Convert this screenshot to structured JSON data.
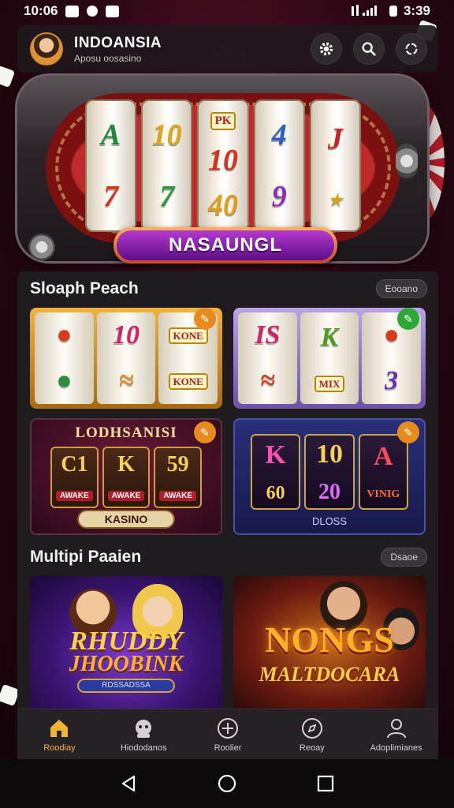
{
  "status_bar": {
    "time": "10:06",
    "clock": "3:39"
  },
  "header": {
    "app_name": "INDOANSIA",
    "subtitle": "Aposu oosasino"
  },
  "hero": {
    "banner": "NASAUNGL",
    "reels": [
      [
        "A",
        "7"
      ],
      [
        "10",
        "7"
      ],
      [
        "10",
        "40"
      ],
      [
        "4",
        "9"
      ],
      [
        "J",
        ""
      ]
    ],
    "tile": "PK"
  },
  "section1": {
    "title": "Sloaph Peach",
    "pill": "Eooano",
    "card1": {
      "reels": [
        [
          "",
          ""
        ],
        [
          "10",
          ""
        ],
        [
          "KONE",
          "KONE"
        ]
      ]
    },
    "card2": {
      "reels": [
        [
          "IS",
          ""
        ],
        [
          "K",
          "MIX"
        ],
        [
          "",
          "3"
        ]
      ]
    },
    "card3": {
      "title": "LODHSANISI",
      "reels": [
        [
          "C1",
          "AWAKE"
        ],
        [
          "K",
          "AWAKE"
        ],
        [
          "59",
          "AWAKE"
        ]
      ],
      "footer": "KASINO"
    },
    "card4": {
      "reels": [
        [
          "K",
          "60"
        ],
        [
          "10",
          "20"
        ],
        [
          "A",
          "VINIG"
        ]
      ],
      "footer": "DLOSS"
    }
  },
  "section2": {
    "title": "Multipi Paaien",
    "pill": "Dsaoe",
    "card1": {
      "title_line1": "RHUDDY",
      "title_line2": "JHOOBINK",
      "tag": "RDSSADSSA"
    },
    "card2": {
      "title_line1": "NONGS",
      "title_line2": "MALTDOCARA"
    }
  },
  "bottom_nav": [
    {
      "label": "Roodiay",
      "icon": "home-icon"
    },
    {
      "label": "Hiododanos",
      "icon": "mascot-icon"
    },
    {
      "label": "Roolier",
      "icon": "plus-circle-icon"
    },
    {
      "label": "Reoay",
      "icon": "compass-icon"
    },
    {
      "label": "Adoplimianes",
      "icon": "profile-icon"
    }
  ],
  "colors": {
    "accent": "#f2b233",
    "banner_purple": "#8a1fb5",
    "panel": "#1f1b1e"
  }
}
